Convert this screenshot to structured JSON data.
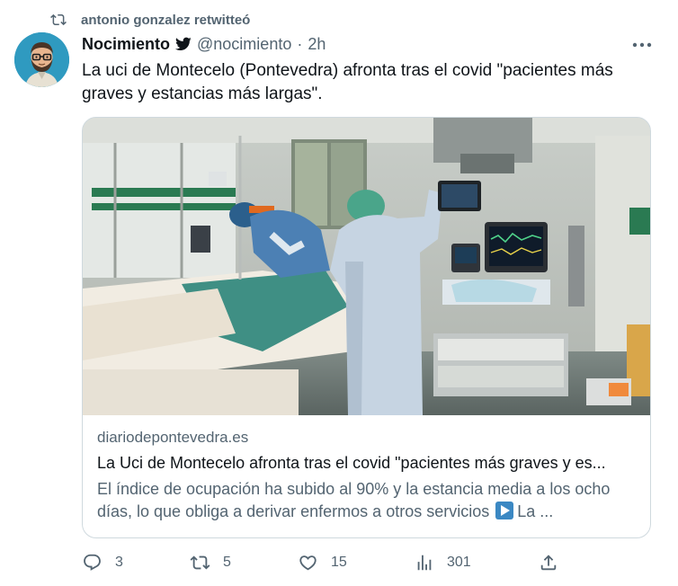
{
  "retweet": {
    "icon": "retweet-icon",
    "text": "antonio gonzalez retwitteó"
  },
  "author": {
    "name": "Nocimiento",
    "badge_icon": "twitter-bird-icon",
    "handle": "@nocimiento",
    "separator": "·",
    "time": "2h"
  },
  "tweet": {
    "text": "La uci de Montecelo (Pontevedra) afronta tras el covid \"pacientes más graves y estancias más largas\"."
  },
  "card": {
    "domain": "diariodepontevedra.es",
    "title": "La Uci de Montecelo afronta tras el covid \"pacientes más graves y es...",
    "desc_start": "El índice de ocupación ha subido al 90% y la estancia media a los ocho días, lo que obliga a derivar enfermos a otros servicios",
    "desc_end": "La ..."
  },
  "actions": {
    "replies": "3",
    "retweets": "5",
    "likes": "15",
    "views": "301"
  },
  "colors": {
    "secondary_text": "#536471",
    "primary_text": "#0f1419",
    "border": "#cfd9de"
  }
}
